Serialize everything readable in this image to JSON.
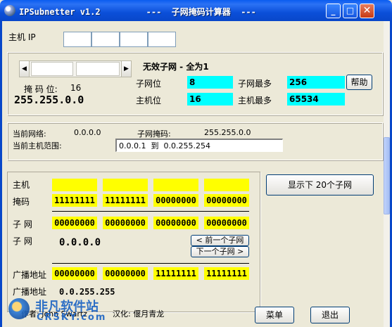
{
  "window": {
    "title": "IPSubnetter v1.2         ---  子网掩码计算器  ---",
    "minimize_glyph": "_",
    "maximize_glyph": "□",
    "close_glyph": "✕",
    "titlebar_color": "#0a5cf0"
  },
  "host_ip": {
    "label": "主机 IP",
    "octets": [
      "",
      "",
      "",
      ""
    ]
  },
  "slider": {
    "left_arrow": "◀",
    "right_arrow": "▶",
    "mask_bits_label": "掩 码 位:",
    "mask_bits_value": "16",
    "mask": "255.255.0.0"
  },
  "subnet_info": {
    "heading": "无效子网 - 全为1",
    "subnet_bits_label": "子网位",
    "subnet_bits_value": "8",
    "max_subnets_label": "子网最多",
    "max_subnets_value": "256",
    "host_bits_label": "主机位",
    "host_bits_value": "16",
    "max_hosts_label": "主机最多",
    "max_hosts_value": "65534",
    "help_button": "帮助",
    "highlight_color": "#00ffff"
  },
  "network": {
    "current_network_label": "当前网络:",
    "current_network_value": "0.0.0.0",
    "subnet_mask_label": "子网掩码:",
    "subnet_mask_value": "255.255.0.0",
    "host_range_label": "当前主机范围:",
    "host_range_value": "0.0.0.1  到  0.0.255.254"
  },
  "binary": {
    "host_label": "主机",
    "host_octets": [
      "",
      "",
      "",
      ""
    ],
    "mask_label": "掩码",
    "mask_octets": [
      "11111111",
      "11111111",
      "00000000",
      "00000000"
    ],
    "subnet_label": "子 网",
    "subnet_octets": [
      "00000000",
      "00000000",
      "00000000",
      "00000000"
    ],
    "subnet_label2": "子 网",
    "subnet_value": "0.0.0.0",
    "prev_subnet_button": "< 前一个子网",
    "next_subnet_button": "下一个子网 >",
    "broadcast_label": "广播地址",
    "broadcast_octets": [
      "00000000",
      "00000000",
      "11111111",
      "11111111"
    ],
    "broadcast_label2": "广播地址",
    "broadcast_value": "0.0.255.255",
    "cell_color": "#ffff00"
  },
  "show_next_button": "显示下 20个子网",
  "footer": {
    "author": "作者: John Swartz",
    "translator": "汉化: 偃月青龙",
    "menu_button": "菜单",
    "exit_button": "退出"
  },
  "watermark": {
    "line1": "非凡软件站",
    "line2": "CRSKY.com"
  }
}
